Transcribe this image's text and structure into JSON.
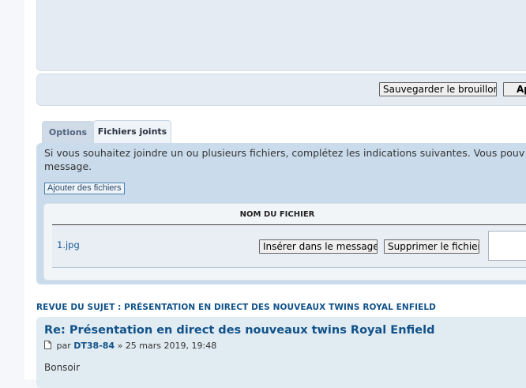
{
  "buttons": {
    "save_draft": "Sauvegarder le brouillon",
    "preview": "Ape"
  },
  "tabs": [
    {
      "label": "Options",
      "active": false
    },
    {
      "label": "Fichiers joints",
      "active": true
    }
  ],
  "attachments": {
    "instructions_line1": "Si vous souhaitez joindre un ou plusieurs fichiers, complétez les indications suivantes. Vous pouv",
    "instructions_line2": "message.",
    "add_files_label": "Ajouter des fichiers",
    "column_header": "NOM DU FICHIER",
    "files": [
      {
        "name": "1.jpg",
        "insert_label": "Insérer dans le message",
        "delete_label": "Supprimer le fichier",
        "comment": ""
      }
    ]
  },
  "review": {
    "heading": "REVUE DU SUJET : PRÉSENTATION EN DIRECT DES NOUVEAUX TWINS ROYAL ENFIELD",
    "post": {
      "title": "Re: Présentation en direct des nouveaux twins Royal Enfield",
      "by_label": "par",
      "author": "DT38-84",
      "separator": "»",
      "date": "25 mars 2019, 19:48",
      "body": "Bonsoir"
    }
  },
  "colors": {
    "link": "#105289",
    "panel": "#cadceb",
    "post_bg": "#e1ebf2"
  }
}
